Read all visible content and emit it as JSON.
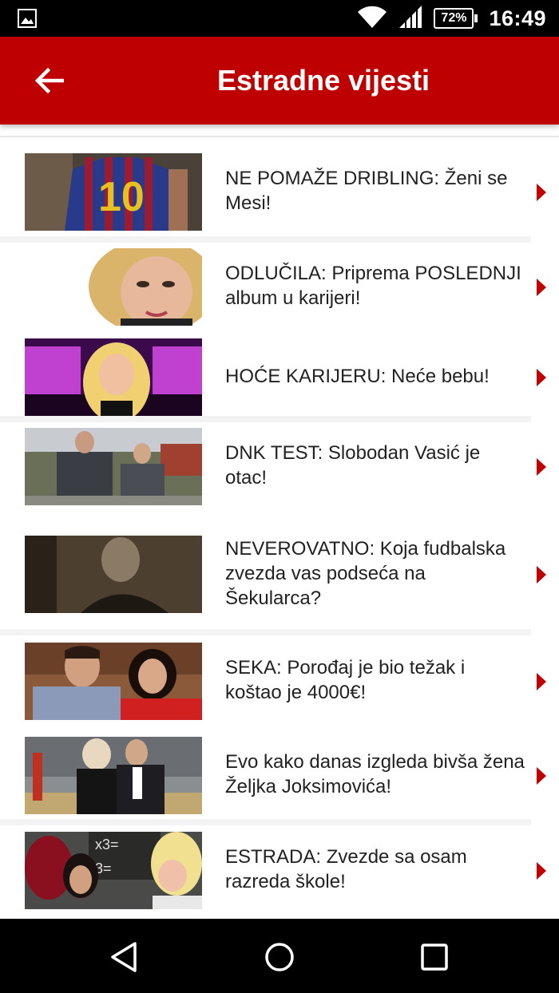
{
  "status_bar": {
    "time": "16:49",
    "battery": "72%",
    "icons": [
      "image-notification-icon",
      "wifi-icon",
      "signal-icon",
      "battery-icon"
    ]
  },
  "app_bar": {
    "title": "Estradne vijesti",
    "back_icon": "arrow-left-icon"
  },
  "news": [
    {
      "headline": "NE POMAŽE DRIBLING: Ženi se Mesi!"
    },
    {
      "headline": "ODLUČILA: Priprema POSLEDNJI album u karijeri!"
    },
    {
      "headline": "HOĆE KARIJERU: Neće bebu!"
    },
    {
      "headline": "DNK TEST: Slobodan Vasić je otac!"
    },
    {
      "headline": "NEVEROVATNO: Koja fudbalska zvezda vas podseća na Šekularca?"
    },
    {
      "headline": "SEKA: Porođaj je bio težak i koštao je 4000€!"
    },
    {
      "headline": "Evo kako danas izgleda bivša žena Željka Joksimovića!"
    },
    {
      "headline": "ESTRADA: Zvezde sa osam razreda škole!"
    }
  ],
  "nav_bar": {
    "icons": [
      "nav-back-icon",
      "nav-home-icon",
      "nav-recents-icon"
    ]
  },
  "colors": {
    "accent": "#bf0000",
    "arrow": "#c00000"
  }
}
